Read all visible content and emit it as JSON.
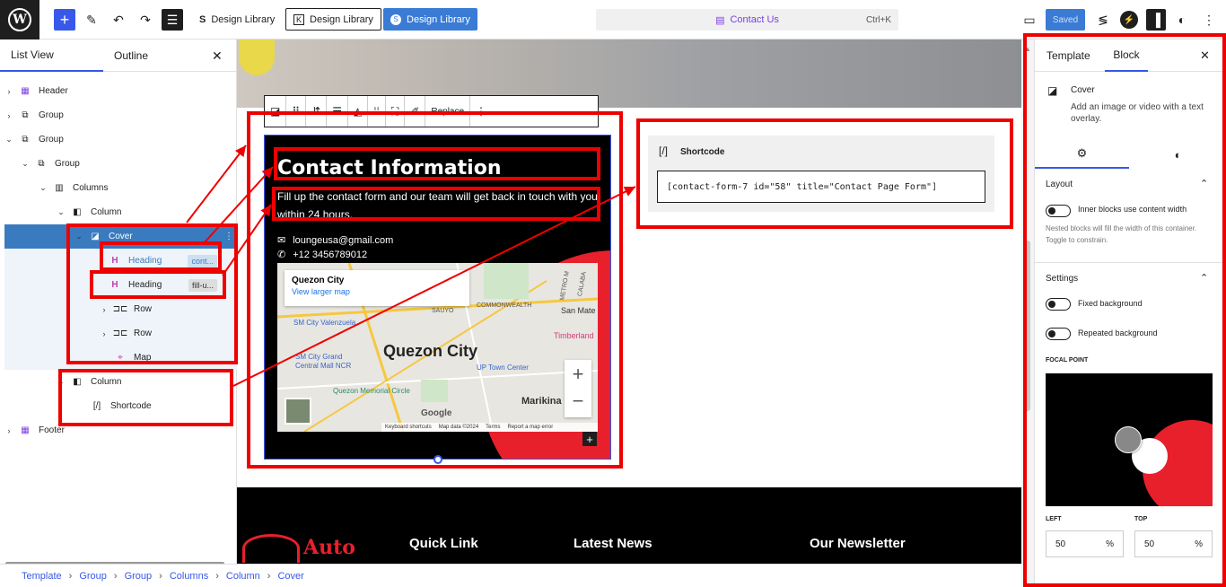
{
  "topbar": {
    "add_icon": "plus-icon",
    "btn1": "Design Library",
    "btn2": "Design Library",
    "btn3": "Design Library",
    "command": "Contact Us",
    "shortcut": "Ctrl+K",
    "saved": "Saved"
  },
  "left": {
    "tab_list": "List View",
    "tab_outline": "Outline",
    "tree": [
      {
        "label": "Header"
      },
      {
        "label": "Group"
      },
      {
        "label": "Group"
      },
      {
        "label": "Group"
      },
      {
        "label": "Columns"
      },
      {
        "label": "Column"
      },
      {
        "label": "Cover"
      },
      {
        "label": "Heading",
        "tag": "cont..."
      },
      {
        "label": "Heading",
        "tag": "fill-u..."
      },
      {
        "label": "Row"
      },
      {
        "label": "Row"
      },
      {
        "label": "Map"
      },
      {
        "label": "Column"
      },
      {
        "label": "Shortcode"
      },
      {
        "label": "Footer"
      }
    ]
  },
  "canvas": {
    "toolbar_replace": "Replace",
    "heading": "Contact Information",
    "description": "Fill up the contact form and our team will get back in touch with you within 24 hours.",
    "email": "loungeusa@gmail.com",
    "phone": "+12 3456789012",
    "map_place": "Quezon City",
    "map_link": "View larger map",
    "map_city_label": "Quezon City",
    "map_labels": [
      "SM City Valenzuela",
      "SM City Grand Central Mall NCR",
      "Quezon Memorial Circle",
      "UP Town Center",
      "Marikina",
      "San Mate",
      "Timberland",
      "COMMONWEALTH",
      "SAUYO",
      "METRO M",
      "CALABA"
    ],
    "map_footer": [
      "Keyboard shortcuts",
      "Map data ©2024",
      "Terms",
      "Report a map error"
    ],
    "google": "Google",
    "shortcode_title": "Shortcode",
    "shortcode_value": "[contact-form-7 id=\"58\" title=\"Contact Page Form\"]",
    "footer_logo": "Auto",
    "footer_headings": [
      "Quick Link",
      "Latest News",
      "Our Newsletter"
    ]
  },
  "right": {
    "tab_template": "Template",
    "tab_block": "Block",
    "block_name": "Cover",
    "block_desc": "Add an image or video with a text overlay.",
    "layout_title": "Layout",
    "inner_blocks": "Inner blocks use content width",
    "inner_help": "Nested blocks will fill the width of this container. Toggle to constrain.",
    "settings_title": "Settings",
    "fixed_bg": "Fixed background",
    "repeated_bg": "Repeated background",
    "focal_point": "FOCAL POINT",
    "left_label": "LEFT",
    "top_label": "TOP",
    "left_value": "50",
    "top_value": "50",
    "pct": "%"
  },
  "breadcrumb": [
    "Template",
    "Group",
    "Group",
    "Columns",
    "Column",
    "Cover"
  ],
  "colors": {
    "accent": "#3858e9",
    "highlight": "#e00000",
    "brand_red": "#e8202c"
  }
}
